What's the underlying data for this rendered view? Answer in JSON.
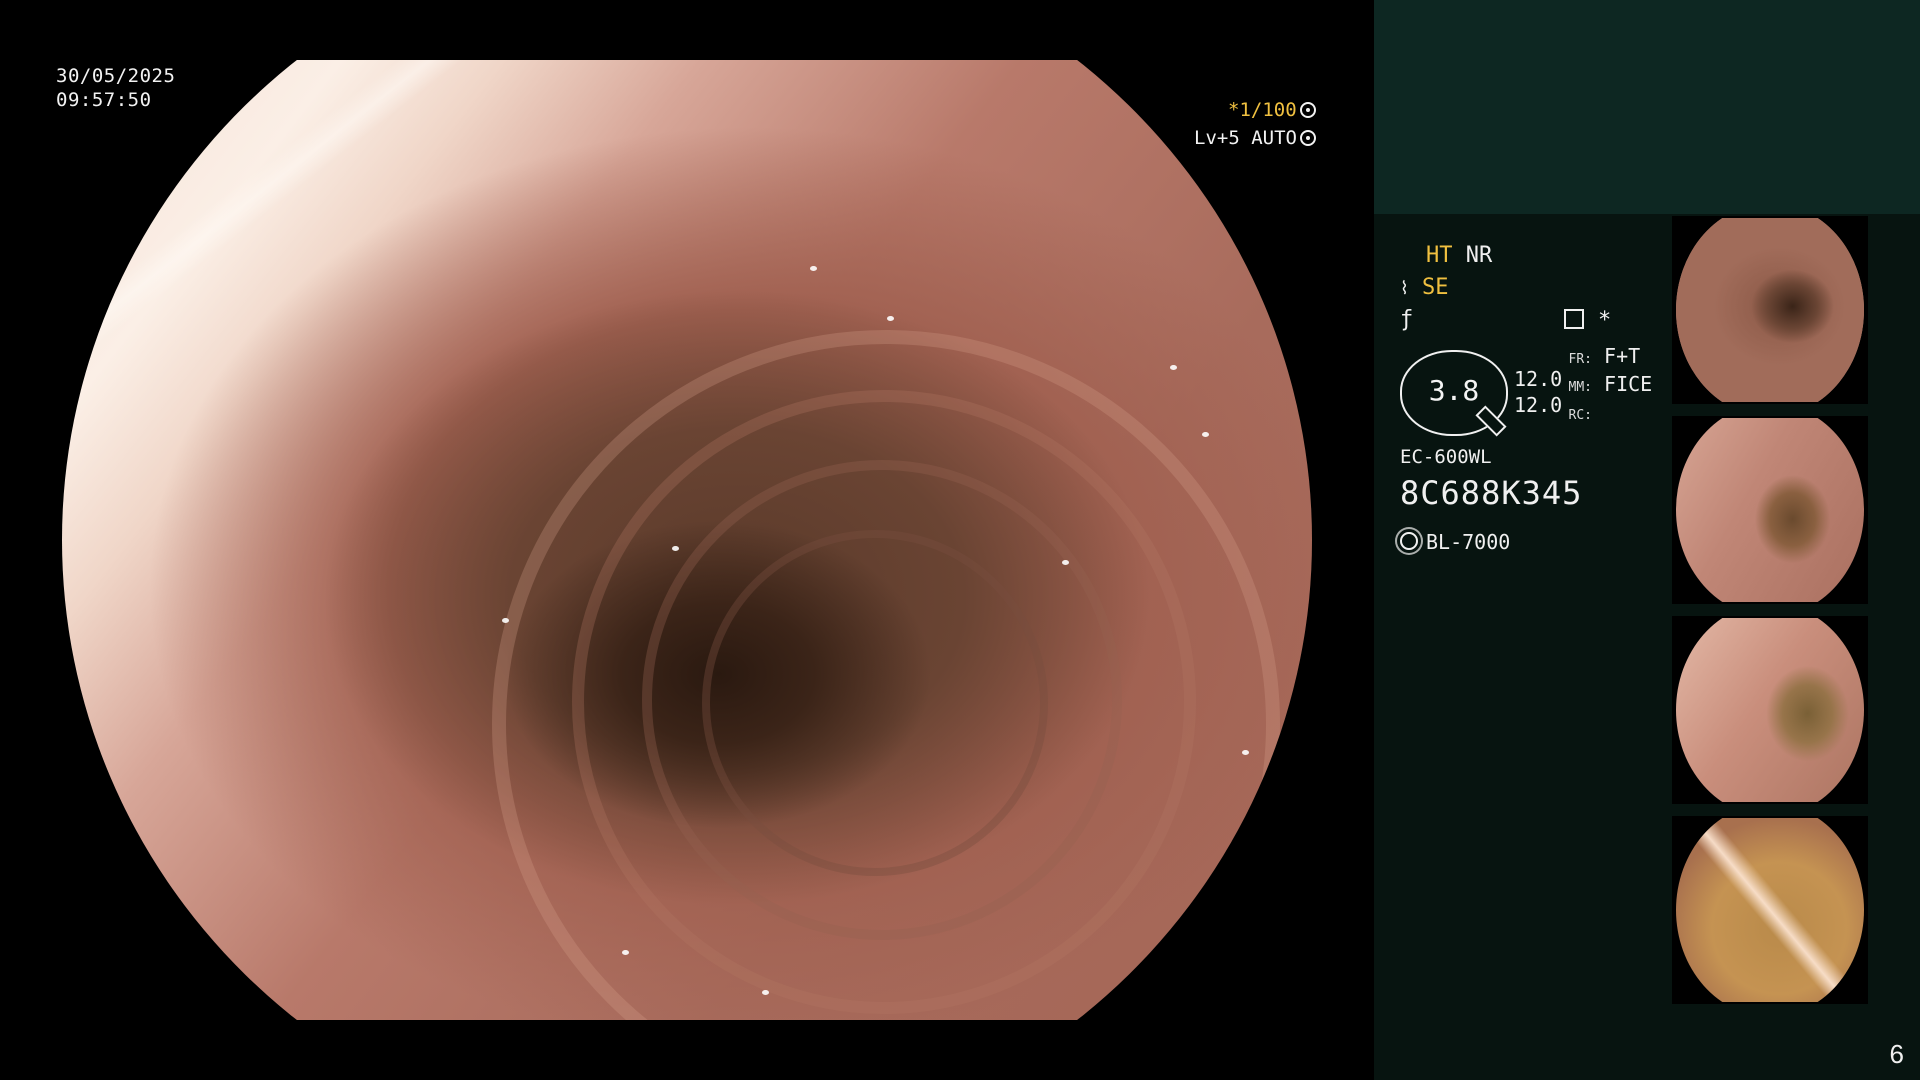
{
  "overlay": {
    "date": "30/05/2025",
    "time": "09:57:50",
    "shutter": "*1/100",
    "shutter_icon": "aperture-icon",
    "level": "Lv+5 AUTO",
    "level_icon": "iris-icon"
  },
  "panel": {
    "ht_label": "HT",
    "nr_label": "NR",
    "se_label": "SE",
    "se_icon": "structure-enhancement-icon",
    "f_icon": "function-icon",
    "record_icon": "record-icon",
    "star": "*",
    "zoom_value": "3.8",
    "val1": "12.0",
    "val2": "12.0",
    "fr_label": "FR:",
    "fr_value": "F+T",
    "mm_label": "MM:",
    "mm_value": "FICE",
    "rc_label": "RC:",
    "rc_value": "",
    "scope_model": "EC-600WL",
    "scope_serial": "8C688K345",
    "light_source": "BL-7000",
    "light_icon": "light-source-icon"
  },
  "page_number": "6",
  "colors": {
    "accent": "#f0c040",
    "panel_bg": "#071410",
    "panel_top": "#0d2722"
  }
}
